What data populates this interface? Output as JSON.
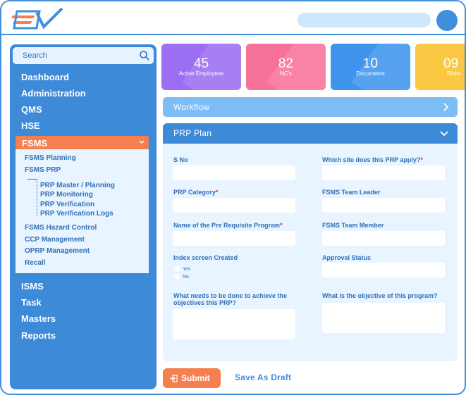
{
  "header": {
    "logo_text": "EV",
    "icons": {
      "logo": "ev-logo",
      "avatar": "user-avatar"
    }
  },
  "sidebar": {
    "search_placeholder": "Search",
    "items_top": [
      "Dashboard",
      "Administration",
      "QMS",
      "HSE"
    ],
    "active_item": "FSMS",
    "sub_items": [
      "FSMS Planning",
      "FSMS PRP"
    ],
    "nested_items": [
      "PRP Master / Planning",
      "PRP Monitoring",
      "PRP Verification",
      "PRP Verification Logs"
    ],
    "sub_items_after": [
      "FSMS Hazard Control",
      "CCP Management",
      "OPRP Management",
      "Recall"
    ],
    "items_bottom": [
      "ISMS",
      "Task",
      "Masters",
      "Reports"
    ]
  },
  "stats": [
    {
      "value": "45",
      "label": "Active Employees",
      "color": "#9b6ef2"
    },
    {
      "value": "82",
      "label": "NC's",
      "color": "#f7729a"
    },
    {
      "value": "10",
      "label": "Documents",
      "color": "#3f95ee"
    },
    {
      "value": "09",
      "label": "Risks",
      "color": "#fbc844"
    }
  ],
  "workflow": {
    "label": "Workflow"
  },
  "prp": {
    "title": "PRP Plan",
    "fields": {
      "s_no": {
        "label": "S No",
        "value": ""
      },
      "site": {
        "label": "Which site does this PRP apply?",
        "value": ""
      },
      "category": {
        "label": "PRP Category",
        "value": ""
      },
      "team_leader": {
        "label": "FSMS Team Leader",
        "value": ""
      },
      "program_name": {
        "label": "Name of the Pre Requisite Program",
        "value": ""
      },
      "team_member": {
        "label": "FSMS Team Member",
        "value": ""
      },
      "index_screen": {
        "label": "Index screen Created",
        "options": [
          "Yes",
          "No"
        ]
      },
      "approval_status": {
        "label": "Approval Status",
        "value": ""
      },
      "needs": {
        "label_line1": "What needs to be done to achieve the",
        "label_line2": "objectives this PRP?",
        "value": ""
      },
      "objective": {
        "label": "What is the objective of this program?",
        "value": ""
      }
    },
    "required_mark": "*"
  },
  "actions": {
    "submit": "Submit",
    "draft": "Save As Draft"
  }
}
